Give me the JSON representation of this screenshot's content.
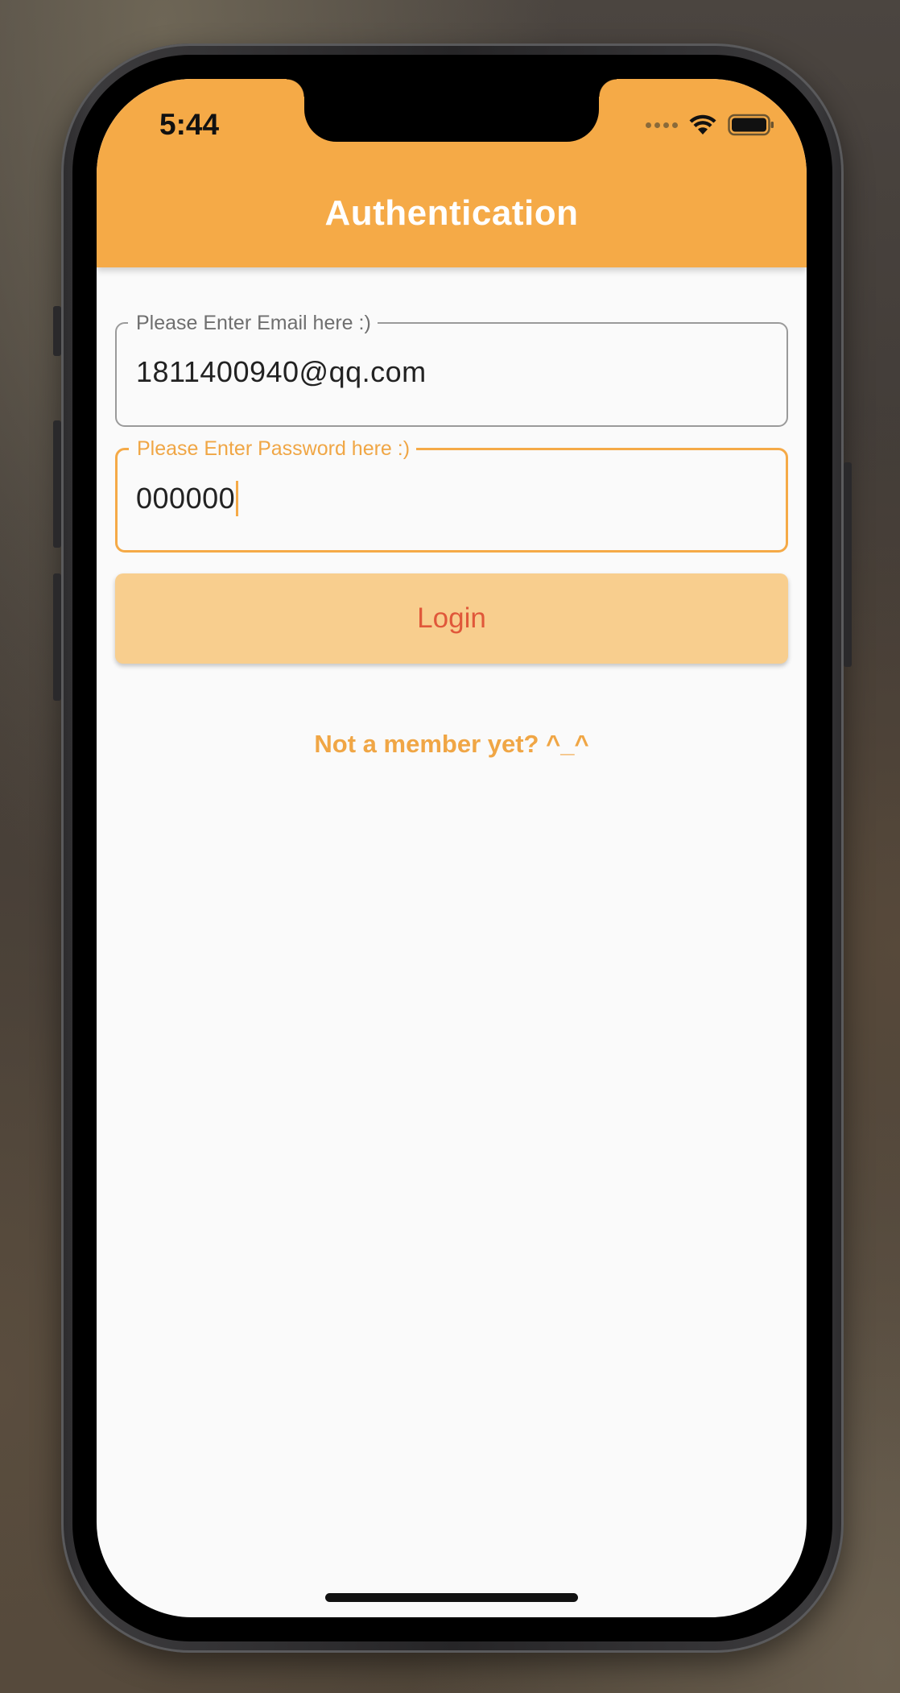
{
  "status_bar": {
    "time": "5:44"
  },
  "app_bar": {
    "title": "Authentication"
  },
  "email_field": {
    "label": "Please Enter Email here :)",
    "value": "1811400940@qq.com"
  },
  "password_field": {
    "label": "Please Enter Password here :)",
    "value": "000000"
  },
  "login_button": {
    "label": "Login"
  },
  "register_link": {
    "label": "Not a member yet? ^_^"
  },
  "colors": {
    "accent": "#f5aa47",
    "button_bg": "#f8ce8e",
    "button_text": "#e0583a",
    "page_bg": "#fafafa"
  },
  "icons": [
    "cellular-signal-icon",
    "wifi-icon",
    "battery-icon"
  ]
}
